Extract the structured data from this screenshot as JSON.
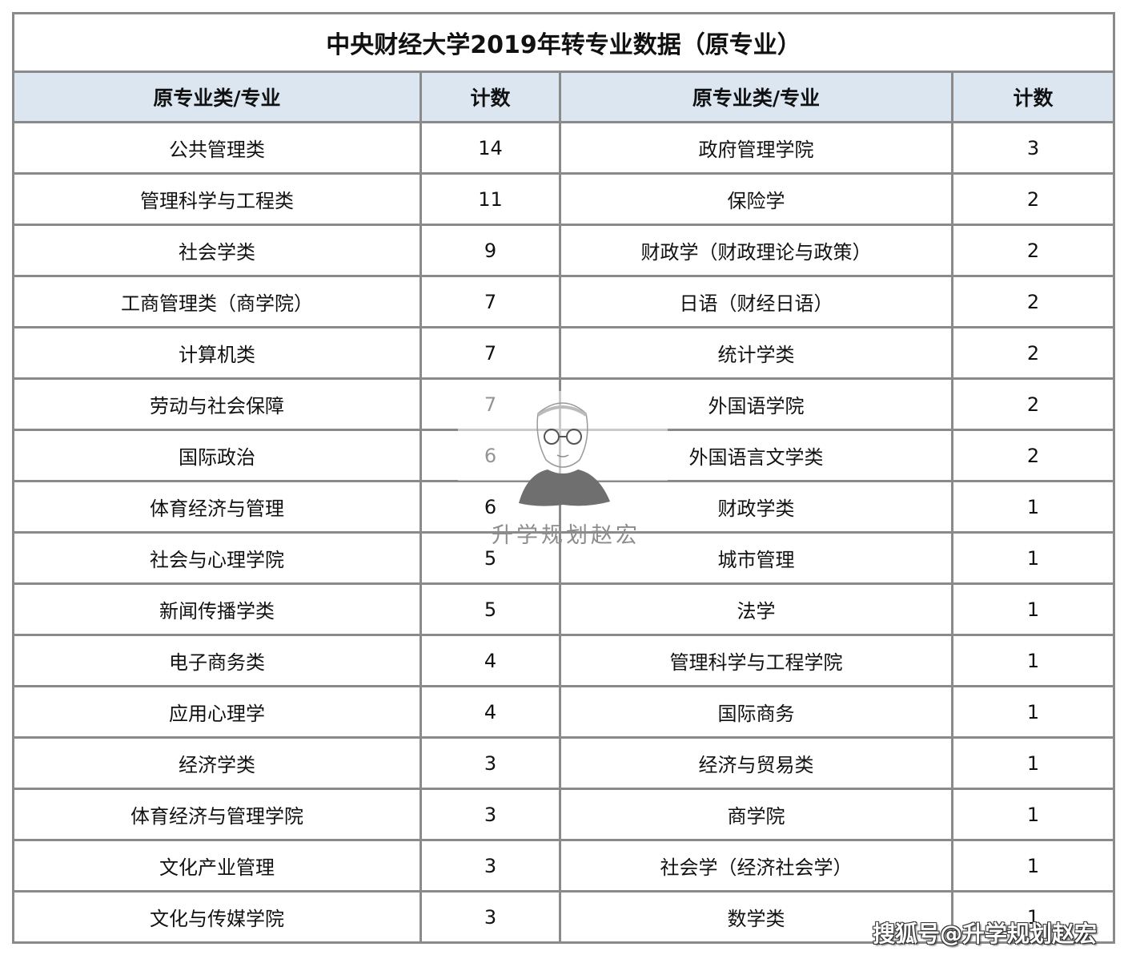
{
  "title": "中央财经大学2019年转专业数据（原专业）",
  "headers": [
    "原专业类/专业",
    "计数",
    "原专业类/专业",
    "计数"
  ],
  "rows": [
    {
      "left_major": "公共管理类",
      "left_count": "14",
      "right_major": "政府管理学院",
      "right_count": "3"
    },
    {
      "left_major": "管理科学与工程类",
      "left_count": "11",
      "right_major": "保险学",
      "right_count": "2"
    },
    {
      "left_major": "社会学类",
      "left_count": "9",
      "right_major": "财政学（财政理论与政策）",
      "right_count": "2"
    },
    {
      "left_major": "工商管理类（商学院）",
      "left_count": "7",
      "right_major": "日语（财经日语）",
      "right_count": "2"
    },
    {
      "left_major": "计算机类",
      "left_count": "7",
      "right_major": "统计学类",
      "right_count": "2"
    },
    {
      "left_major": "劳动与社会保障",
      "left_count": "7",
      "right_major": "外国语学院",
      "right_count": "2"
    },
    {
      "left_major": "国际政治",
      "left_count": "6",
      "right_major": "外国语言文学类",
      "right_count": "2"
    },
    {
      "left_major": "体育经济与管理",
      "left_count": "6",
      "right_major": "财政学类",
      "right_count": "1"
    },
    {
      "left_major": "社会与心理学院",
      "left_count": "5",
      "right_major": "城市管理",
      "right_count": "1"
    },
    {
      "left_major": "新闻传播学类",
      "left_count": "5",
      "right_major": "法学",
      "right_count": "1"
    },
    {
      "left_major": "电子商务类",
      "left_count": "4",
      "right_major": "管理科学与工程学院",
      "right_count": "1"
    },
    {
      "left_major": "应用心理学",
      "left_count": "4",
      "right_major": "国际商务",
      "right_count": "1"
    },
    {
      "left_major": "经济学类",
      "left_count": "3",
      "right_major": "经济与贸易类",
      "right_count": "1"
    },
    {
      "left_major": "体育经济与管理学院",
      "left_count": "3",
      "right_major": "商学院",
      "right_count": "1"
    },
    {
      "left_major": "文化产业管理",
      "left_count": "3",
      "right_major": "社会学（经济社会学）",
      "right_count": "1"
    },
    {
      "left_major": "文化与传媒学院",
      "left_count": "3",
      "right_major": "数学类",
      "right_count": "1"
    }
  ],
  "watermark": {
    "text": "升学规划赵宏",
    "icon": "portrait-sketch-icon"
  },
  "footer_watermark": "搜狐号@升学规划赵宏",
  "colors": {
    "header_bg": "#dce6f1",
    "border": "#8a8a8a"
  }
}
